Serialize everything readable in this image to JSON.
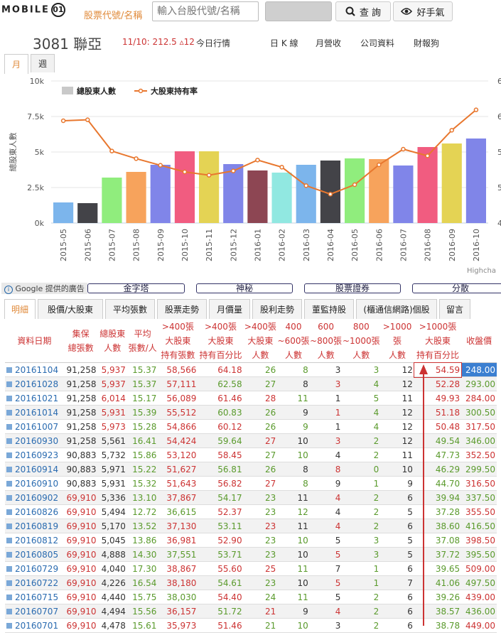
{
  "logo": {
    "text": "MOBILE",
    "o": "01"
  },
  "search": {
    "label": "股票代號/名稱",
    "placeholder": "輸入台股代號/名稱",
    "query_label": "查 詢",
    "hot_label": "好手氣"
  },
  "stock": {
    "code": "3081",
    "name": "聯亞",
    "price": "11/10: 212.5 ▵12"
  },
  "nav": [
    "今日行情",
    "日 K 線",
    "月營收",
    "公司資料",
    "財報狗"
  ],
  "period_tabs": [
    "月",
    "週"
  ],
  "chart_data": {
    "type": "bar+line",
    "categories": [
      "2015-05",
      "2015-06",
      "2015-07",
      "2015-08",
      "2015-09",
      "2015-10",
      "2015-11",
      "2015-12",
      "2016-01",
      "2016-02",
      "2016-03",
      "2016-04",
      "2016-05",
      "2016-06",
      "2016-07",
      "2016-08",
      "2016-09",
      "2016-10"
    ],
    "series": [
      {
        "name": "總股東人數",
        "type": "bar",
        "values": [
          1450,
          1400,
          3200,
          3600,
          4100,
          5050,
          5050,
          4150,
          3700,
          3550,
          4100,
          4400,
          4550,
          4500,
          4050,
          5350,
          5600,
          5950
        ],
        "colors": [
          "#7cb5ec",
          "#434348",
          "#90ed7d",
          "#f7a35c",
          "#8085e9",
          "#f15c80",
          "#e4d354",
          "#8085e8",
          "#8d4653",
          "#91e8e1",
          "#7cb5ec",
          "#434348",
          "#90ed7d",
          "#f7a35c",
          "#8085e9",
          "#f15c80",
          "#e4d354",
          "#8085e8"
        ]
      },
      {
        "name": "大股東持有率",
        "type": "line",
        "values": [
          61.6,
          61.8,
          55.2,
          53.6,
          52.2,
          50.8,
          50.1,
          51.0,
          53.3,
          51.8,
          47.9,
          46.1,
          48.1,
          52.3,
          55.6,
          54.2,
          59.6,
          63.9
        ],
        "color": "#e8772e"
      }
    ],
    "ylabel": "總股東人數",
    "yticks": [
      "0k",
      "2.5k",
      "5k",
      "7.5k",
      "10k"
    ],
    "ylim": [
      0,
      10000
    ],
    "y2ticks": [
      "4",
      "5",
      "5",
      "6",
      "6"
    ],
    "y2lim": [
      40,
      70
    ],
    "credit": "Highcha"
  },
  "ads": {
    "google": "Google 提供的廣告",
    "links": [
      "金字塔",
      "神秘",
      "股票證券",
      "分散"
    ]
  },
  "data_tabs": [
    "明細",
    "股價/大股東",
    "平均張數",
    "股票走勢",
    "月價量",
    "股利走勢",
    "董監持股",
    "(櫃通信網路)個股",
    "留言"
  ],
  "table": {
    "headers": [
      [
        "資料日期"
      ],
      [
        "集保",
        "總張數"
      ],
      [
        "總股東",
        "人數"
      ],
      [
        "平均",
        "張數/人"
      ],
      [
        ">400張",
        "大股東",
        "持有張數"
      ],
      [
        ">400張",
        "大股東",
        "持有百分比"
      ],
      [
        ">400張",
        "大股東",
        "人數"
      ],
      [
        "400",
        "~600張",
        "人數"
      ],
      [
        "600",
        "~800張",
        "人數"
      ],
      [
        "800",
        "~1000張",
        "人數"
      ],
      [
        ">1000張",
        "人數"
      ],
      [
        ">1000張",
        "大股東",
        "持有百分比"
      ],
      [
        "收盤價"
      ]
    ],
    "rows": [
      [
        "20161104",
        "91,258",
        "5,937",
        "15.37",
        "58,566",
        "64.18",
        "26",
        "8",
        "3",
        "3",
        "12",
        "54.59",
        "248.00"
      ],
      [
        "20161028",
        "91,258",
        "5,937",
        "15.37",
        "57,111",
        "62.58",
        "27",
        "8",
        "3",
        "4",
        "12",
        "52.28",
        "293.00"
      ],
      [
        "20161021",
        "91,258",
        "6,014",
        "15.17",
        "56,089",
        "61.46",
        "28",
        "11",
        "1",
        "5",
        "11",
        "49.93",
        "284.00"
      ],
      [
        "20161014",
        "91,258",
        "5,931",
        "15.39",
        "55,512",
        "60.83",
        "26",
        "9",
        "1",
        "4",
        "12",
        "51.18",
        "300.50"
      ],
      [
        "20161007",
        "91,258",
        "5,973",
        "15.28",
        "54,866",
        "60.12",
        "26",
        "9",
        "1",
        "4",
        "12",
        "50.48",
        "317.50"
      ],
      [
        "20160930",
        "91,258",
        "5,561",
        "16.41",
        "54,424",
        "59.64",
        "27",
        "10",
        "3",
        "2",
        "12",
        "49.54",
        "346.00"
      ],
      [
        "20160923",
        "90,883",
        "5,732",
        "15.86",
        "53,120",
        "58.45",
        "27",
        "10",
        "4",
        "2",
        "11",
        "47.73",
        "352.50"
      ],
      [
        "20160914",
        "90,883",
        "5,971",
        "15.22",
        "51,627",
        "56.81",
        "26",
        "8",
        "8",
        "0",
        "10",
        "46.29",
        "299.50"
      ],
      [
        "20160910",
        "90,883",
        "5,931",
        "15.32",
        "51,643",
        "56.82",
        "27",
        "8",
        "9",
        "1",
        "9",
        "44.70",
        "316.50"
      ],
      [
        "20160902",
        "69,910",
        "5,336",
        "13.10",
        "37,867",
        "54.17",
        "23",
        "11",
        "4",
        "2",
        "6",
        "39.94",
        "337.50"
      ],
      [
        "20160826",
        "69,910",
        "5,494",
        "12.72",
        "36,615",
        "52.37",
        "23",
        "12",
        "4",
        "2",
        "5",
        "37.28",
        "355.50"
      ],
      [
        "20160819",
        "69,910",
        "5,170",
        "13.52",
        "37,130",
        "53.11",
        "23",
        "11",
        "4",
        "2",
        "6",
        "38.60",
        "416.50"
      ],
      [
        "20160812",
        "69,910",
        "5,045",
        "13.86",
        "36,981",
        "52.90",
        "23",
        "10",
        "5",
        "3",
        "5",
        "37.08",
        "398.50"
      ],
      [
        "20160805",
        "69,910",
        "4,888",
        "14.30",
        "37,551",
        "53.71",
        "23",
        "10",
        "5",
        "3",
        "5",
        "37.72",
        "395.50"
      ],
      [
        "20160729",
        "69,910",
        "4,040",
        "17.30",
        "38,867",
        "55.60",
        "25",
        "11",
        "7",
        "1",
        "6",
        "39.65",
        "509.00"
      ],
      [
        "20160722",
        "69,910",
        "4,226",
        "16.54",
        "38,180",
        "54.61",
        "23",
        "10",
        "5",
        "1",
        "7",
        "41.06",
        "497.50"
      ],
      [
        "20160715",
        "69,910",
        "4,440",
        "15.75",
        "38,030",
        "54.40",
        "24",
        "11",
        "5",
        "2",
        "6",
        "39.26",
        "439.00"
      ],
      [
        "20160707",
        "69,910",
        "4,494",
        "15.56",
        "36,157",
        "51.72",
        "21",
        "9",
        "4",
        "2",
        "6",
        "38.57",
        "436.00"
      ],
      [
        "20160701",
        "69,910",
        "4,478",
        "15.61",
        "35,973",
        "51.46",
        "21",
        "10",
        "3",
        "2",
        "6",
        "38.78",
        "449.00"
      ]
    ]
  }
}
